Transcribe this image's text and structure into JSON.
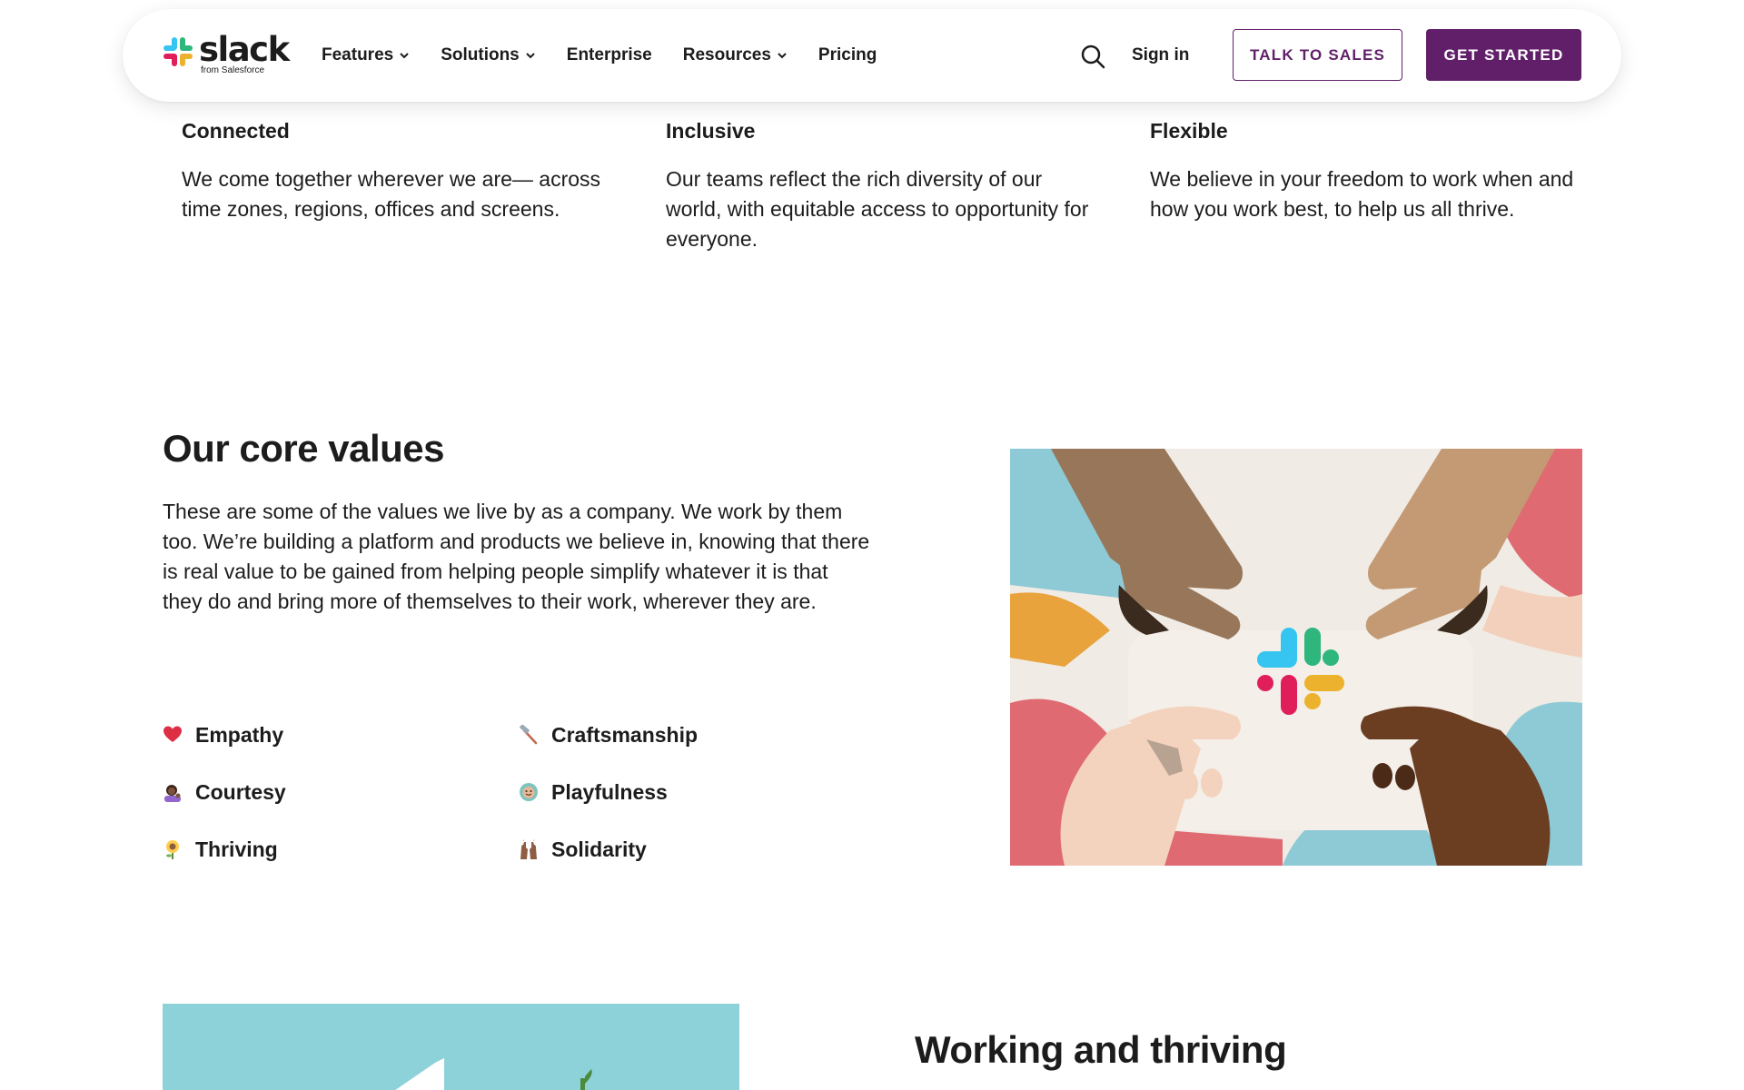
{
  "nav": {
    "logo_word": "slack",
    "logo_sub": "from Salesforce",
    "links": [
      {
        "label": "Features",
        "has_menu": true
      },
      {
        "label": "Solutions",
        "has_menu": true
      },
      {
        "label": "Enterprise",
        "has_menu": false
      },
      {
        "label": "Resources",
        "has_menu": true
      },
      {
        "label": "Pricing",
        "has_menu": false
      }
    ],
    "search_icon": "search-icon",
    "sign_in": "Sign in",
    "talk_to_sales": "TALK TO SALES",
    "get_started": "GET STARTED",
    "colors": {
      "brand": "#611f69",
      "text": "#1d1c1d"
    }
  },
  "principles": [
    {
      "title": "Connected",
      "text": "We come together wherever we are— across time zones, regions, offices and screens."
    },
    {
      "title": "Inclusive",
      "text": "Our teams reflect the rich diversity of our world, with equitable access to opportunity for everyone."
    },
    {
      "title": "Flexible",
      "text": "We believe in your freedom to work when and how you work best, to help us all thrive."
    }
  ],
  "core": {
    "title": "Our core values",
    "description": "These are some of the values we live by as a company. We work by them too. We’re building a platform and products we believe in, knowing that there is real value to be gained from helping people simplify whatever it is that they do and bring more of themselves to their work, wherever they are.",
    "values": [
      {
        "label": "Empathy",
        "icon": "heart-icon"
      },
      {
        "label": "Courtesy",
        "icon": "person-tipping-hand-icon"
      },
      {
        "label": "Thriving",
        "icon": "sunflower-icon"
      },
      {
        "label": "Craftsmanship",
        "icon": "hammer-icon"
      },
      {
        "label": "Playfulness",
        "icon": "slightly-smiling-face-icon"
      },
      {
        "label": "Solidarity",
        "icon": "raised-hands-icon"
      }
    ],
    "illustration": "hands-holding-slack-logo-illustration"
  },
  "thriving": {
    "title": "Working and thriving"
  }
}
